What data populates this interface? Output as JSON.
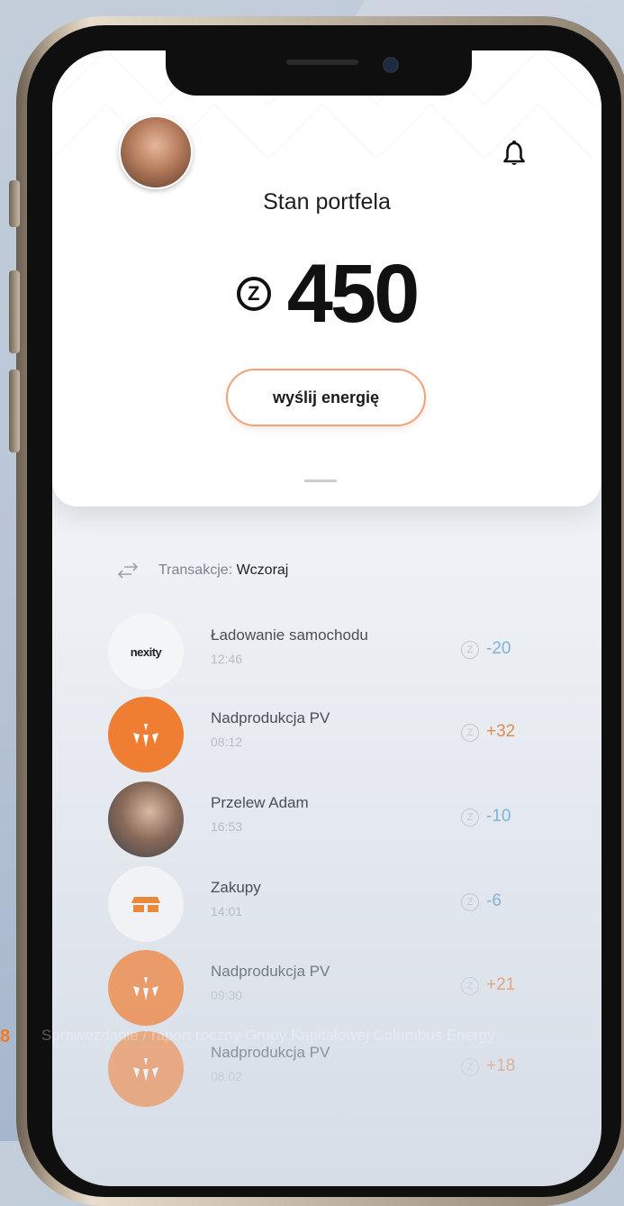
{
  "header": {
    "title": "Stan portfela",
    "notification_icon": "bell-icon"
  },
  "balance": {
    "currency_symbol": "Z",
    "amount": "450"
  },
  "actions": {
    "send_label": "wyślij energię"
  },
  "transactions": {
    "section_label": "Transakcje:",
    "section_day": "Wczoraj",
    "items": [
      {
        "name": "Ładowanie samochodu",
        "time": "12:46",
        "value": "-20",
        "logo_text": "nexity",
        "coin": "Z"
      },
      {
        "name": "Nadprodukcja PV",
        "time": "08:12",
        "value": "+32",
        "logo_text": "",
        "coin": "Z"
      },
      {
        "name": "Przelew Adam",
        "time": "16:53",
        "value": "-10",
        "logo_text": "",
        "coin": "Z"
      },
      {
        "name": "Zakupy",
        "time": "14:01",
        "value": "-6",
        "logo_text": "",
        "coin": "Z"
      },
      {
        "name": "Nadprodukcja PV",
        "time": "09:30",
        "value": "+21",
        "logo_text": "",
        "coin": "Z"
      },
      {
        "name": "Nadprodukcja PV",
        "time": "08:02",
        "value": "+18",
        "logo_text": "",
        "coin": "Z"
      }
    ]
  },
  "footer": {
    "page_number": "8",
    "text": "Sprawozdanie / raport roczny Grupy Kapitałowej Columbus Energy"
  },
  "colors": {
    "accent_orange": "#ef7d32",
    "negative_blue": "#7fb3d8",
    "positive_orange": "#e38a52"
  }
}
